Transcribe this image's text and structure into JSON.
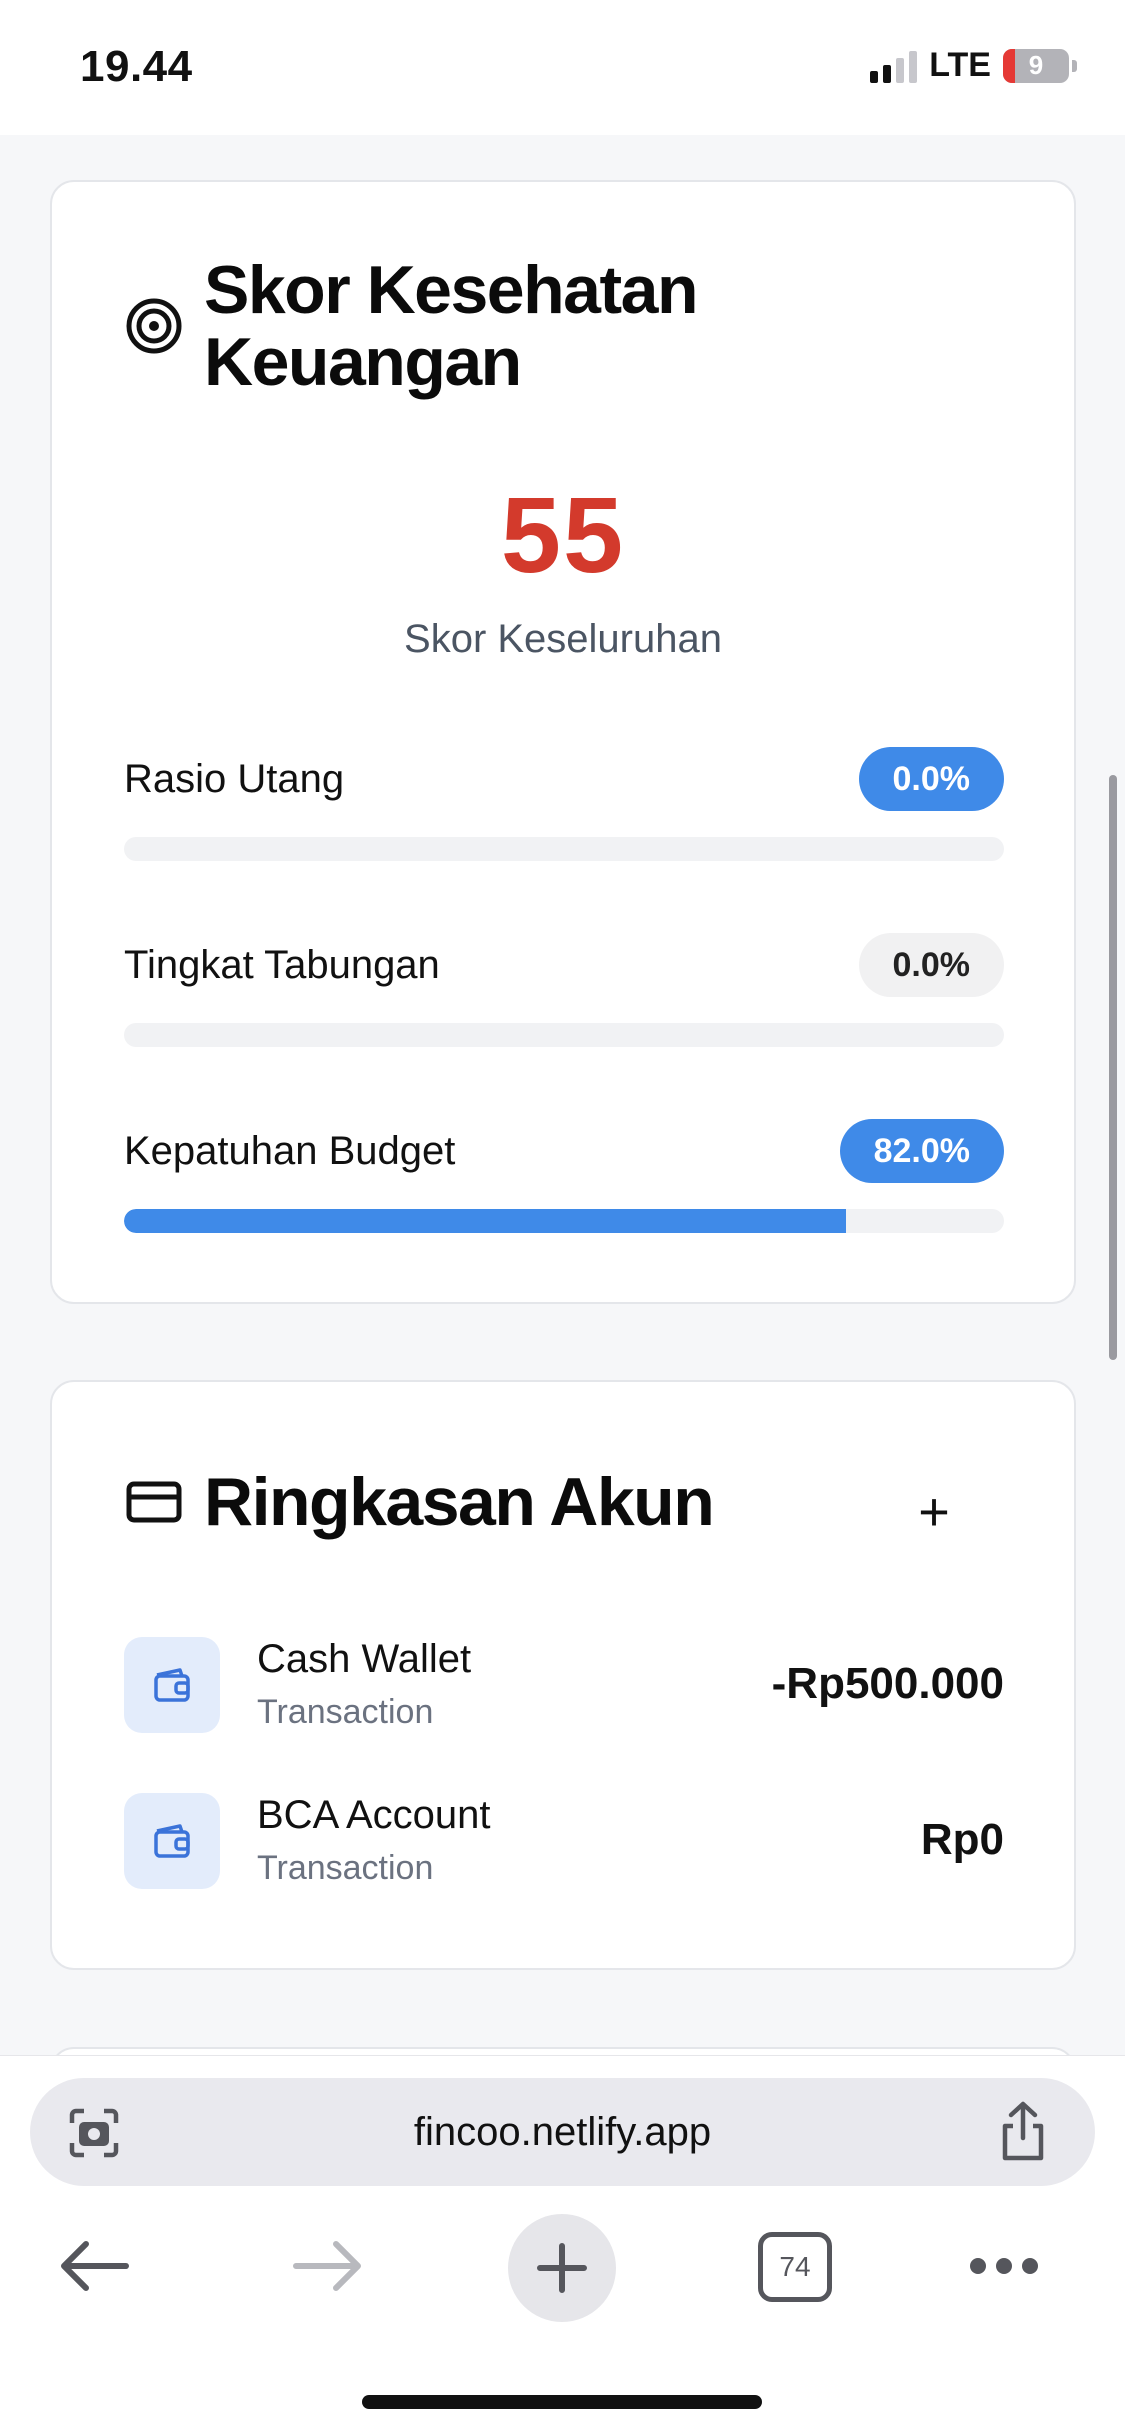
{
  "status_bar": {
    "time": "19.44",
    "network": "LTE",
    "battery": "9"
  },
  "health_card": {
    "title_line1": "Skor Kesehatan",
    "title_line2": "Keuangan",
    "title_icon": "target-icon",
    "score": "55",
    "score_label": "Skor Keseluruhan",
    "metrics": [
      {
        "label": "Rasio Utang",
        "value": "0.0%",
        "fill_percent": 0,
        "badge_style": "blue"
      },
      {
        "label": "Tingkat Tabungan",
        "value": "0.0%",
        "fill_percent": 0,
        "badge_style": "gray"
      },
      {
        "label": "Kepatuhan Budget",
        "value": "82.0%",
        "fill_percent": 82,
        "badge_style": "blue"
      }
    ],
    "colors": {
      "score": "#d33a2c",
      "accent": "#3f8ae8"
    }
  },
  "accounts_card": {
    "title": "Ringkasan Akun",
    "title_icon": "credit-card-icon",
    "add_label": "+",
    "accounts": [
      {
        "name": "Cash Wallet",
        "type": "Transaction",
        "balance": "-Rp500.000",
        "icon": "wallet-icon"
      },
      {
        "name": "BCA Account",
        "type": "Transaction",
        "balance": "Rp0",
        "icon": "wallet-icon"
      }
    ]
  },
  "browser": {
    "url": "fincoo.netlify.app",
    "tab_count": "74"
  }
}
